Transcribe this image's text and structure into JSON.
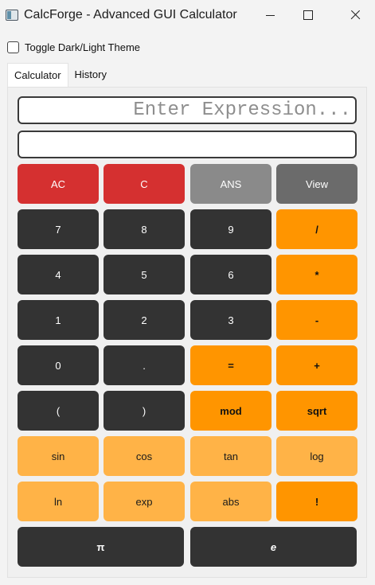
{
  "window": {
    "title": "CalcForge - Advanced GUI Calculator"
  },
  "theme_toggle": {
    "label": "Toggle Dark/Light Theme",
    "checked": false
  },
  "tabs": [
    {
      "label": "Calculator",
      "active": true
    },
    {
      "label": "History",
      "active": false
    }
  ],
  "expression": {
    "placeholder": "Enter Expression...",
    "value": ""
  },
  "result": {
    "value": ""
  },
  "keys": {
    "ac": "AC",
    "clear": "C",
    "ans": "ANS",
    "view": "View",
    "seven": "7",
    "eight": "8",
    "nine": "9",
    "divide": "/",
    "four": "4",
    "five": "5",
    "six": "6",
    "multiply": "*",
    "one": "1",
    "two": "2",
    "three": "3",
    "subtract": "-",
    "zero": "0",
    "dot": ".",
    "equals": "=",
    "add": "+",
    "lparen": "(",
    "rparen": ")",
    "mod": "mod",
    "sqrt": "sqrt",
    "sin": "sin",
    "cos": "cos",
    "tan": "tan",
    "log": "log",
    "ln": "ln",
    "exp": "exp",
    "abs": "abs",
    "factorial": "!",
    "pi": "π",
    "e": "e"
  },
  "colors": {
    "clear_red": "#d53030",
    "ans_gray": "#8a8a8a",
    "view_gray": "#6b6b6b",
    "digit_dark": "#333333",
    "operator_orange": "#ff9500",
    "function_light_orange": "#ffb347"
  }
}
